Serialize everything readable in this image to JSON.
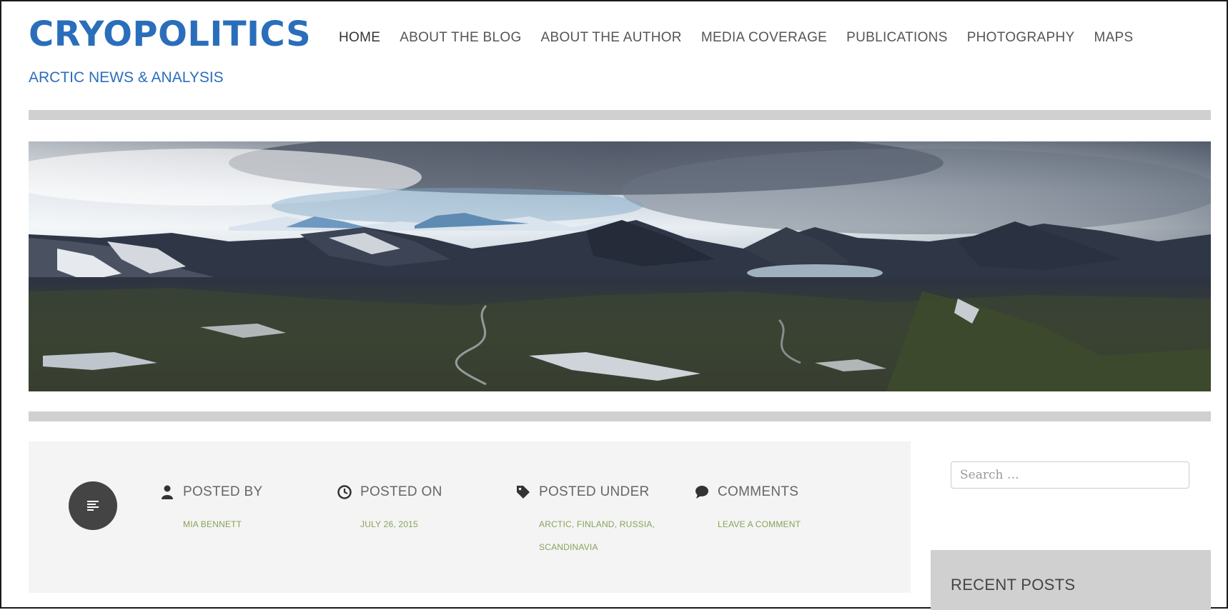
{
  "site": {
    "title": "CRYOPOLITICS",
    "tagline": "ARCTIC NEWS & ANALYSIS",
    "brand_color": "#2a6ebb"
  },
  "nav": {
    "items": [
      {
        "label": "HOME"
      },
      {
        "label": "ABOUT THE BLOG"
      },
      {
        "label": "ABOUT THE AUTHOR"
      },
      {
        "label": "MEDIA COVERAGE"
      },
      {
        "label": "PUBLICATIONS"
      },
      {
        "label": "PHOTOGRAPHY"
      },
      {
        "label": "MAPS"
      }
    ]
  },
  "hero": {
    "icon": "landscape-banner-image"
  },
  "post_meta": {
    "format_icon": "text-format-icon",
    "posted_by": {
      "label": "POSTED BY",
      "icon": "user-icon",
      "value": "MIA BENNETT"
    },
    "posted_on": {
      "label": "POSTED ON",
      "icon": "clock-icon",
      "value": "JULY 26, 2015"
    },
    "posted_under": {
      "label": "POSTED UNDER",
      "icon": "tag-icon",
      "line1": "ARCTIC, FINLAND, RUSSIA,",
      "line2": "SCANDINAVIA"
    },
    "comments": {
      "label": "COMMENTS",
      "icon": "comment-icon",
      "value": "LEAVE A COMMENT"
    },
    "link_color": "#8aa15a"
  },
  "sidebar": {
    "search_placeholder": "Search …",
    "recent_posts_title": "RECENT POSTS"
  }
}
